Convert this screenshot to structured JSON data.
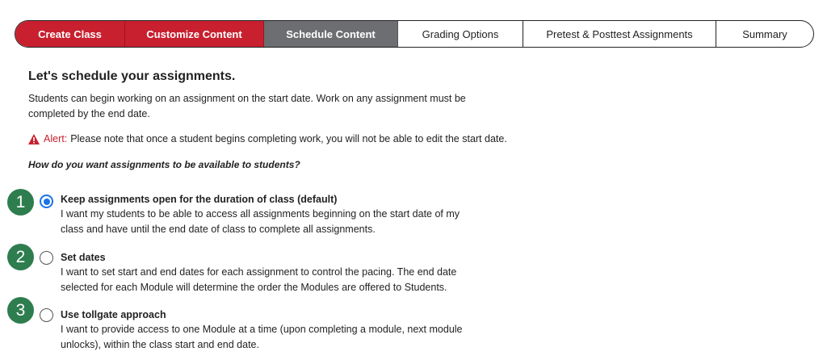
{
  "stepper": {
    "steps": [
      {
        "label": "Create Class",
        "state": "done"
      },
      {
        "label": "Customize Content",
        "state": "done"
      },
      {
        "label": "Schedule Content",
        "state": "current"
      },
      {
        "label": "Grading Options",
        "state": "upcoming"
      },
      {
        "label": "Pretest & Posttest Assignments",
        "state": "upcoming"
      },
      {
        "label": "Summary",
        "state": "upcoming"
      }
    ]
  },
  "main": {
    "heading": "Let's schedule your assignments.",
    "intro": "Students can begin working on an assignment on the start date. Work on any assignment must be completed by the end date.",
    "alert": {
      "label": "Alert:",
      "text": "Please note that once a student begins completing work, you will not be able to edit the start date."
    },
    "question": "How do you want assignments to be available to students?",
    "options": [
      {
        "badge": "1",
        "title": "Keep assignments open for the duration of class (default)",
        "description": "I want my students to be able to access all assignments beginning on the start date of my class and have until the end date of class to complete all assignments.",
        "selected": true
      },
      {
        "badge": "2",
        "title": "Set dates",
        "description": "I want to set start and end dates for each assignment to control the pacing. The end date selected for each Module will determine the order the Modules are offered to Students.",
        "selected": false
      },
      {
        "badge": "3",
        "title": "Use tollgate approach",
        "description": "I want to provide access to one Module at a time (upon completing a module, next module unlocks), within the class start and end date.",
        "selected": false
      }
    ]
  },
  "colors": {
    "brand_red": "#c8202f",
    "current_gray": "#6d6e71",
    "badge_green": "#2e7d4f",
    "radio_blue": "#1a73e8"
  }
}
